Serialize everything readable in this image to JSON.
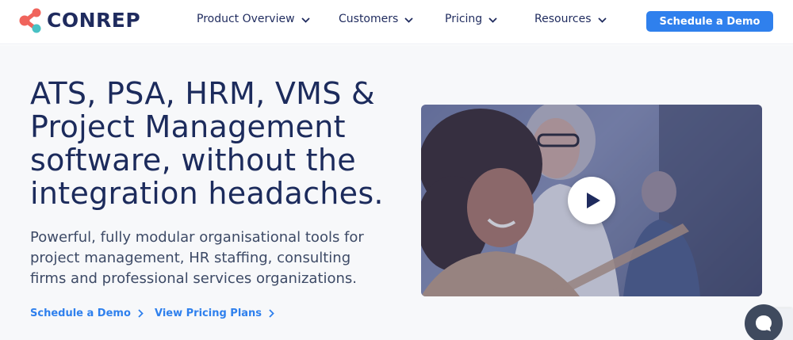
{
  "brand": {
    "name": "CONREP",
    "colors": {
      "coral": "#f0645c",
      "teal": "#48c1c4",
      "navy": "#1f2b5e"
    }
  },
  "nav": {
    "items": [
      {
        "label": "Product Overview",
        "icon": "chevron-down-icon"
      },
      {
        "label": "Customers",
        "icon": "chevron-down-icon"
      },
      {
        "label": "Pricing",
        "icon": "chevron-down-icon"
      },
      {
        "label": "Resources",
        "icon": "chevron-down-icon"
      }
    ],
    "cta_label": "Schedule a Demo",
    "cta_color": "#2f80ed"
  },
  "hero": {
    "title": "ATS, PSA, HRM, VMS & Project Management software, without the integration headaches.",
    "subtitle": "Powerful, fully modular organisational tools for project management, HR staffing, consulting firms and professional services organizations.",
    "links": [
      {
        "label": "Schedule a Demo",
        "icon": "chevron-right-icon"
      },
      {
        "label": "View Pricing Plans",
        "icon": "chevron-right-icon"
      }
    ]
  },
  "video": {
    "play_icon": "play-icon"
  },
  "chat": {
    "icon": "chat-bubble-icon"
  }
}
